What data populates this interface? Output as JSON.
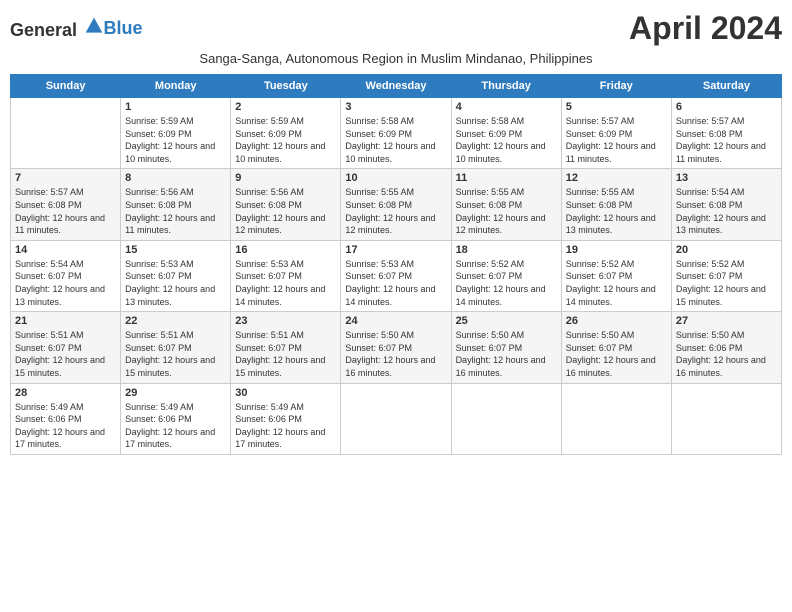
{
  "logo": {
    "general": "General",
    "blue": "Blue"
  },
  "title": "April 2024",
  "subtitle": "Sanga-Sanga, Autonomous Region in Muslim Mindanao, Philippines",
  "days_header": [
    "Sunday",
    "Monday",
    "Tuesday",
    "Wednesday",
    "Thursday",
    "Friday",
    "Saturday"
  ],
  "weeks": [
    [
      {
        "day": "",
        "info": ""
      },
      {
        "day": "1",
        "info": "Sunrise: 5:59 AM\nSunset: 6:09 PM\nDaylight: 12 hours and 10 minutes."
      },
      {
        "day": "2",
        "info": "Sunrise: 5:59 AM\nSunset: 6:09 PM\nDaylight: 12 hours and 10 minutes."
      },
      {
        "day": "3",
        "info": "Sunrise: 5:58 AM\nSunset: 6:09 PM\nDaylight: 12 hours and 10 minutes."
      },
      {
        "day": "4",
        "info": "Sunrise: 5:58 AM\nSunset: 6:09 PM\nDaylight: 12 hours and 10 minutes."
      },
      {
        "day": "5",
        "info": "Sunrise: 5:57 AM\nSunset: 6:09 PM\nDaylight: 12 hours and 11 minutes."
      },
      {
        "day": "6",
        "info": "Sunrise: 5:57 AM\nSunset: 6:08 PM\nDaylight: 12 hours and 11 minutes."
      }
    ],
    [
      {
        "day": "7",
        "info": "Sunrise: 5:57 AM\nSunset: 6:08 PM\nDaylight: 12 hours and 11 minutes."
      },
      {
        "day": "8",
        "info": "Sunrise: 5:56 AM\nSunset: 6:08 PM\nDaylight: 12 hours and 11 minutes."
      },
      {
        "day": "9",
        "info": "Sunrise: 5:56 AM\nSunset: 6:08 PM\nDaylight: 12 hours and 12 minutes."
      },
      {
        "day": "10",
        "info": "Sunrise: 5:55 AM\nSunset: 6:08 PM\nDaylight: 12 hours and 12 minutes."
      },
      {
        "day": "11",
        "info": "Sunrise: 5:55 AM\nSunset: 6:08 PM\nDaylight: 12 hours and 12 minutes."
      },
      {
        "day": "12",
        "info": "Sunrise: 5:55 AM\nSunset: 6:08 PM\nDaylight: 12 hours and 13 minutes."
      },
      {
        "day": "13",
        "info": "Sunrise: 5:54 AM\nSunset: 6:08 PM\nDaylight: 12 hours and 13 minutes."
      }
    ],
    [
      {
        "day": "14",
        "info": "Sunrise: 5:54 AM\nSunset: 6:07 PM\nDaylight: 12 hours and 13 minutes."
      },
      {
        "day": "15",
        "info": "Sunrise: 5:53 AM\nSunset: 6:07 PM\nDaylight: 12 hours and 13 minutes."
      },
      {
        "day": "16",
        "info": "Sunrise: 5:53 AM\nSunset: 6:07 PM\nDaylight: 12 hours and 14 minutes."
      },
      {
        "day": "17",
        "info": "Sunrise: 5:53 AM\nSunset: 6:07 PM\nDaylight: 12 hours and 14 minutes."
      },
      {
        "day": "18",
        "info": "Sunrise: 5:52 AM\nSunset: 6:07 PM\nDaylight: 12 hours and 14 minutes."
      },
      {
        "day": "19",
        "info": "Sunrise: 5:52 AM\nSunset: 6:07 PM\nDaylight: 12 hours and 14 minutes."
      },
      {
        "day": "20",
        "info": "Sunrise: 5:52 AM\nSunset: 6:07 PM\nDaylight: 12 hours and 15 minutes."
      }
    ],
    [
      {
        "day": "21",
        "info": "Sunrise: 5:51 AM\nSunset: 6:07 PM\nDaylight: 12 hours and 15 minutes."
      },
      {
        "day": "22",
        "info": "Sunrise: 5:51 AM\nSunset: 6:07 PM\nDaylight: 12 hours and 15 minutes."
      },
      {
        "day": "23",
        "info": "Sunrise: 5:51 AM\nSunset: 6:07 PM\nDaylight: 12 hours and 15 minutes."
      },
      {
        "day": "24",
        "info": "Sunrise: 5:50 AM\nSunset: 6:07 PM\nDaylight: 12 hours and 16 minutes."
      },
      {
        "day": "25",
        "info": "Sunrise: 5:50 AM\nSunset: 6:07 PM\nDaylight: 12 hours and 16 minutes."
      },
      {
        "day": "26",
        "info": "Sunrise: 5:50 AM\nSunset: 6:07 PM\nDaylight: 12 hours and 16 minutes."
      },
      {
        "day": "27",
        "info": "Sunrise: 5:50 AM\nSunset: 6:06 PM\nDaylight: 12 hours and 16 minutes."
      }
    ],
    [
      {
        "day": "28",
        "info": "Sunrise: 5:49 AM\nSunset: 6:06 PM\nDaylight: 12 hours and 17 minutes."
      },
      {
        "day": "29",
        "info": "Sunrise: 5:49 AM\nSunset: 6:06 PM\nDaylight: 12 hours and 17 minutes."
      },
      {
        "day": "30",
        "info": "Sunrise: 5:49 AM\nSunset: 6:06 PM\nDaylight: 12 hours and 17 minutes."
      },
      {
        "day": "",
        "info": ""
      },
      {
        "day": "",
        "info": ""
      },
      {
        "day": "",
        "info": ""
      },
      {
        "day": "",
        "info": ""
      }
    ]
  ]
}
